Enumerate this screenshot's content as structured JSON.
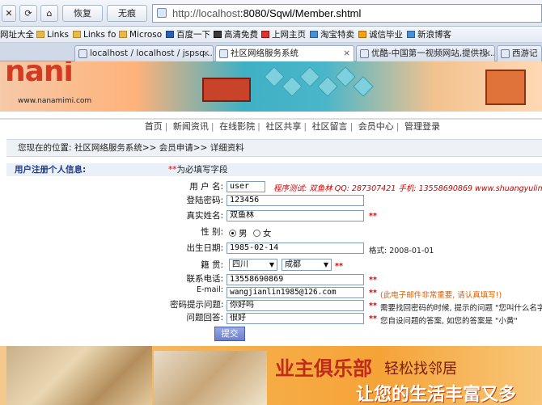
{
  "toolbar": {
    "back": "✕",
    "refresh": "⟳",
    "home": "⌂",
    "restore": "恢复",
    "nothing": "无痕",
    "url_host": "http://localhost",
    "url_rest": ":8080/Sqwl/Member.shtml"
  },
  "bookmarks": [
    "网址大全",
    "Links",
    "Links fo",
    "Microso",
    "百度一下",
    "高清免费",
    "上网主页",
    "淘宝特卖",
    "诚信毕业",
    "新浪博客"
  ],
  "tabs": [
    {
      "label": "localhost / localhost / jspsq..."
    },
    {
      "label": "社区网络服务系统",
      "active": true
    },
    {
      "label": "优酷-中国第一视频网站,提供视..."
    },
    {
      "label": "西游记"
    }
  ],
  "banner": {
    "logo": "nani",
    "sub": "www.nanamimi.com"
  },
  "nav": [
    "首页",
    "新闻资讯",
    "在线影院",
    "社区共享",
    "社区留言",
    "会员中心",
    "管理登录"
  ],
  "breadcrumb": "您现在的位置: 社区网络服务系统>> 会员申请>> 详细资料",
  "form_header": {
    "title": "用户注册个人信息:",
    "required_mark": "**",
    "required_text": "为必填写字段"
  },
  "form": {
    "username_label": "用 户 名:",
    "username": "user",
    "promo": "程序测试: 双鱼林  QQ: 287307421  手机: 13558690869  www.shuangyulin.com",
    "password_label": "登陆密码:",
    "password": "123456",
    "realname_label": "真实姓名:",
    "realname": "双鱼林",
    "gender_label": "性    别:",
    "male": "男",
    "female": "女",
    "birthday_label": "出生日期:",
    "birthday": "1985-02-14",
    "birthday_hint": "格式: 2008-01-01",
    "origin_label": "籍    贯:",
    "province": "四川",
    "city": "成都",
    "phone_label": "联系电话:",
    "phone": "13558690869",
    "email_label": "E-mail:",
    "email": "wangjianlin1985@126.com",
    "email_hint": "(此电子邮件非常重要, 请认真填写!)",
    "question_label": "密码提示问题:",
    "question": "你好吗",
    "question_hint": "需要找回密码的时候, 提示的问题 \"您叫什么名字",
    "answer_label": "问题回答:",
    "answer": "很好",
    "answer_hint": "您自设问题的答案, 如您的答案是 \"小黄\"",
    "req": "**",
    "submit": "提交"
  },
  "bottom_banner": {
    "line1": "业主俱乐部",
    "line2": "轻松找邻居",
    "line3": "让您的生活丰富又多"
  },
  "colors": {
    "accent": "#e00000",
    "link": "#1e3c8c"
  }
}
